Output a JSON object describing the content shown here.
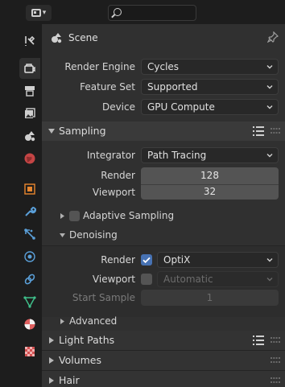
{
  "search": {
    "placeholder": ""
  },
  "header": {
    "title": "Scene"
  },
  "render_engine": {
    "label": "Render Engine",
    "value": "Cycles"
  },
  "feature_set": {
    "label": "Feature Set",
    "value": "Supported"
  },
  "device": {
    "label": "Device",
    "value": "GPU Compute"
  },
  "sampling": {
    "title": "Sampling",
    "integrator": {
      "label": "Integrator",
      "value": "Path Tracing"
    },
    "render": {
      "label": "Render",
      "value": "128"
    },
    "viewport": {
      "label": "Viewport",
      "value": "32"
    },
    "adaptive": {
      "title": "Adaptive Sampling",
      "checked": false
    },
    "denoising": {
      "title": "Denoising",
      "render": {
        "label": "Render",
        "checked": true,
        "value": "OptiX"
      },
      "viewport": {
        "label": "Viewport",
        "checked": false,
        "value": "Automatic"
      },
      "start_sample": {
        "label": "Start Sample",
        "value": "1"
      }
    },
    "advanced": {
      "title": "Advanced"
    }
  },
  "light_paths": {
    "title": "Light Paths"
  },
  "volumes": {
    "title": "Volumes"
  },
  "hair": {
    "title": "Hair"
  },
  "colors": {
    "accent": "#4772b3",
    "panel": "#303030",
    "field": "#545454"
  },
  "tabs": [
    "tool-icon",
    "render-icon",
    "output-icon",
    "view-layer-icon",
    "scene-icon",
    "world-icon",
    "object-icon",
    "modifier-icon",
    "particles-icon",
    "physics-icon",
    "constraints-icon",
    "object-data-icon",
    "material-icon",
    "texture-icon"
  ]
}
